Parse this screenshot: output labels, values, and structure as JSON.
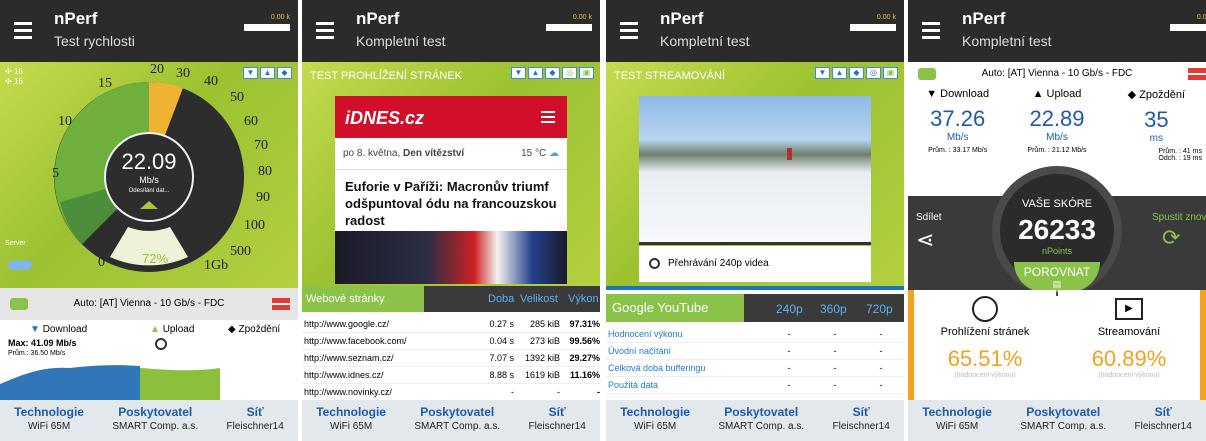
{
  "app": {
    "title": "nPerf",
    "speed_mini": "0.00 k"
  },
  "footer": {
    "labels": [
      "Technologie",
      "Poskytovatel",
      "Síť"
    ],
    "values": [
      "WiFi 65M",
      "SMART Comp. a.s.",
      "Fleischner14"
    ]
  },
  "p1": {
    "subtitle": "Test rychlosti",
    "counts": [
      "16",
      "16"
    ],
    "ticks": [
      "0",
      "5",
      "10",
      "15",
      "20",
      "30",
      "40",
      "50",
      "60",
      "70",
      "80",
      "90",
      "100",
      "500",
      "1Gb"
    ],
    "speed_value": "22.09",
    "speed_unit": "Mb/s",
    "speed_status": "Odesílání dat...",
    "progress_percent": "72%",
    "progress": 0.72,
    "server_label": "Server",
    "server_name": "Auto: [AT] Vienna - 10 Gb/s - FDC",
    "tabs": {
      "download": "Download",
      "upload": "Upload",
      "latency": "Zpoždění"
    },
    "max": "Max: 41.09 Mb/s",
    "avg": "Prům.: 36.50 Mb/s"
  },
  "p2": {
    "subtitle": "Kompletní test",
    "section": "TEST PROHLÍŽENÍ STRÁNEK",
    "site": {
      "logo": "iDNES.cz",
      "date_pre": "po 8. května, ",
      "date_bold": "Den vítězství",
      "temp": "15 °C",
      "headline": "Euforie v Paříži: Macronův triumf odšpuntoval ódu na francouzskou radost"
    },
    "table": {
      "title": "Webové stránky",
      "cols": [
        "Doba",
        "Velikost",
        "Výkon"
      ],
      "rows": [
        [
          "http://www.google.cz/",
          "0.27 s",
          "285 kiB",
          "97.31%"
        ],
        [
          "http://www.facebook.com/",
          "0.04 s",
          "273 kiB",
          "99.56%"
        ],
        [
          "http://www.seznam.cz/",
          "7.07 s",
          "1392 kiB",
          "29.27%"
        ],
        [
          "http://www.idnes.cz/",
          "8.88 s",
          "1619 kiB",
          "11.16%"
        ],
        [
          "http://www.novinky.cz/",
          "-",
          "-",
          "-"
        ]
      ]
    }
  },
  "p3": {
    "subtitle": "Kompletní test",
    "section": "TEST STREAMOVÁNÍ",
    "playing": "Přehrávání 240p videa",
    "table": {
      "title": "Google YouTube",
      "cols": [
        "240p",
        "360p",
        "720p"
      ],
      "rows": [
        [
          "Hodnocení výkonu",
          "-",
          "-",
          "-"
        ],
        [
          "Úvodní načítání",
          "-",
          "-",
          "-"
        ],
        [
          "Celková doba bufferingu",
          "-",
          "-",
          "-"
        ],
        [
          "Použitá data",
          "-",
          "-",
          "-"
        ]
      ]
    }
  },
  "p4": {
    "subtitle": "Kompletní test",
    "server_name": "Auto: [AT] Vienna - 10 Gb/s - FDC",
    "download": {
      "label": "Download",
      "value": "37.26",
      "unit": "Mb/s",
      "avg": "Prům. : 33.17 Mb/s"
    },
    "upload": {
      "label": "Upload",
      "value": "22.89",
      "unit": "Mb/s",
      "avg": "Prům. : 21.12 Mb/s"
    },
    "latency": {
      "label": "Zpoždění",
      "value": "35",
      "unit": "ms",
      "avg": "Prům. : 41 ms",
      "dev": "Odch. : 19 ms"
    },
    "score": {
      "label": "VAŠE SKÓRE",
      "value": "26233",
      "unit": "nPoints",
      "compare": "POROVNAT"
    },
    "share": "Sdílet",
    "restart": "Spustit znov",
    "browse": {
      "label": "Prohlížení stránek",
      "value": "65.51%",
      "sub": "(hodnocení výkonu)"
    },
    "stream": {
      "label": "Streamování",
      "value": "60.89%",
      "sub": "(hodnocení výkonu)"
    }
  }
}
